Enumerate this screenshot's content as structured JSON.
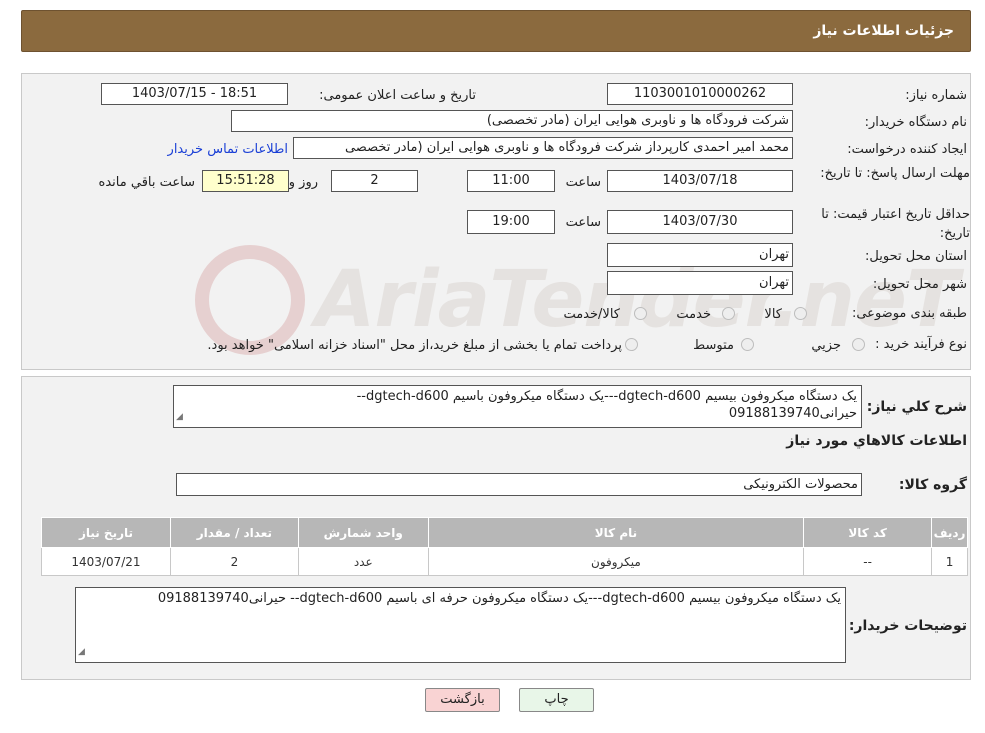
{
  "header": {
    "title": "جزئیات اطلاعات نیاز"
  },
  "form": {
    "need_number_label": "شماره نیاز:",
    "need_number": "1103001010000262",
    "announce_label": "تاریخ و ساعت اعلان عمومی:",
    "announce_value": "1403/07/15 - 18:51",
    "buyer_org_label": "نام دستگاه خریدار:",
    "buyer_org": "شرکت فرودگاه ها و ناوبری هوایی ایران (مادر تخصصی)",
    "requester_label": "ایجاد کننده درخواست:",
    "requester": "محمد امیر احمدی کارپرداز شرکت فرودگاه ها و ناوبری هوایی ایران (مادر تخصصی",
    "contact_link": "اطلاعات تماس خریدار",
    "deadline_label": "مهلت ارسال پاسخ: تا تاریخ:",
    "deadline_date": "1403/07/18",
    "time_label": "ساعت",
    "deadline_time": "11:00",
    "days_value": "2",
    "days_label": "روز و",
    "remaining_time": "15:51:28",
    "remaining_label": "ساعت باقي مانده",
    "validity_label": "حداقل تاریخ اعتبار قیمت: تا تاریخ:",
    "validity_date": "1403/07/30",
    "validity_time": "19:00",
    "province_label": "استان محل تحویل:",
    "province": "تهران",
    "city_label": "شهر محل تحویل:",
    "city": "تهران",
    "category_label": "طبقه بندی موضوعی:",
    "category_options": [
      "کالا",
      "خدمت",
      "کالا/خدمت"
    ],
    "process_label": "نوع فرآیند خرید :",
    "process_options": [
      "جزیي",
      "متوسط"
    ],
    "process_note": "پرداخت تمام یا بخشی از مبلغ خرید،از محل \"اسناد خزانه اسلامی\" خواهد بود."
  },
  "description": {
    "label": "شرح کلي نیاز:",
    "line1": "یک دستگاه میکروفون بیسیم dgtech-d600---یک دستگاه میکروفون باسیم dgtech-d600--",
    "line2": "حیرانی09188139740"
  },
  "goods": {
    "section_title": "اطلاعات کالاهاي مورد نیاز",
    "group_label": "گروه کالا:",
    "group_value": "محصولات الکترونیکی",
    "table": {
      "headers": [
        "ردیف",
        "کد کالا",
        "نام کالا",
        "واحد شمارش",
        "تعداد / مقدار",
        "تاریخ نیاز"
      ],
      "rows": [
        [
          "1",
          "--",
          "میکروفون",
          "عدد",
          "2",
          "1403/07/21"
        ]
      ]
    }
  },
  "buyer_notes": {
    "label": "توضیحات خریدار:",
    "text": "یک دستگاه میکروفون بیسیم dgtech-d600---یک دستگاه میکروفون  حرفه ای باسیم dgtech-d600-- حیرانی09188139740"
  },
  "buttons": {
    "print": "چاپ",
    "back": "بازگشت"
  },
  "colors": {
    "header_bg": "#8b6a3e",
    "table_header_bg": "#b7b7b7",
    "back_btn_bg": "#f9d3d3",
    "print_btn_bg": "#e8f6e8"
  }
}
